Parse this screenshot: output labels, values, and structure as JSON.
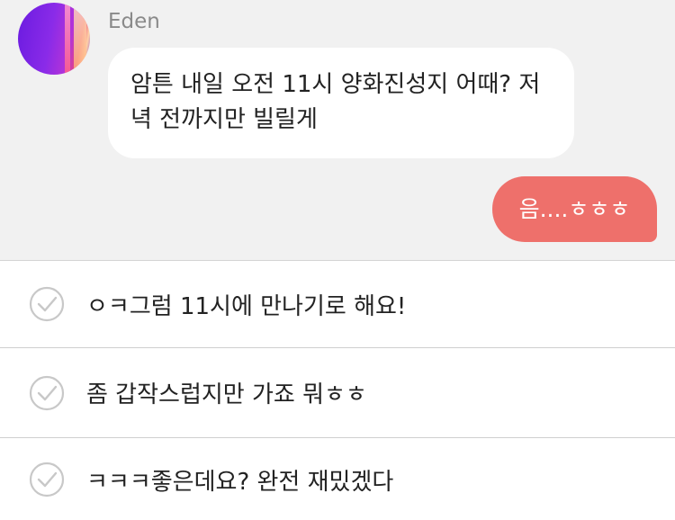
{
  "chat": {
    "sender_name": "Eden",
    "incoming_message_line1": "암튼 내일 오전 11시 양화진성지 어때? 저",
    "incoming_message_line2": "녁 전까지만 빌릴게",
    "outgoing_message": "음....ㅎㅎㅎ",
    "outgoing_color": "#ee706b"
  },
  "reply_options": [
    {
      "label": "ㅇㅋ그럼 11시에 만나기로 해요!",
      "icon": "check-circle-icon"
    },
    {
      "label": "좀 갑작스럽지만 가죠 뭐ㅎㅎ",
      "icon": "check-circle-icon"
    },
    {
      "label": "ㅋㅋㅋ좋은데요? 완전 재밌겠다",
      "icon": "check-circle-icon"
    }
  ]
}
